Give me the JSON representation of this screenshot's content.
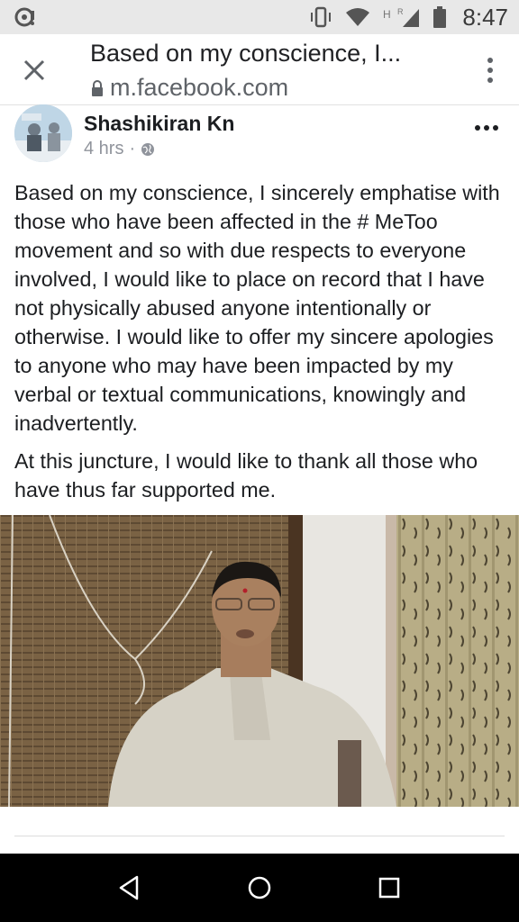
{
  "status_bar": {
    "time": "8:47",
    "icons": [
      "notification-icon",
      "vibrate-icon",
      "wifi-icon",
      "h-signal-icon",
      "battery-icon"
    ],
    "network_label": "H",
    "roaming_label": "R"
  },
  "tab_header": {
    "title": "Based on my conscience, I...",
    "url": "m.facebook.com",
    "close_icon": "close-icon",
    "menu_icon": "overflow-menu-icon"
  },
  "post": {
    "author": "Shashikiran Kn",
    "time": "4 hrs",
    "separator": "·",
    "privacy_icon": "globe-icon",
    "paragraphs": [
      "Based on my conscience, I sincerely emphatise with those who have been affected in the # MeToo movement and so with due respects to everyone involved, I would like to place on record that I have not physically abused anyone intentionally or otherwise. I would like to offer my sincere apologies to anyone who may have been impacted by my verbal or textual communications, knowingly and inadvertently.",
      "At this juncture, I would like to thank all those who have thus far supported me."
    ]
  },
  "nav_bar": {
    "icons": [
      "back-icon",
      "home-icon",
      "recents-icon"
    ]
  },
  "colors": {
    "status_bar_bg": "#e8e8e8",
    "nav_bar_bg": "#000000",
    "text": "#1c1e21",
    "meta": "#90949c"
  }
}
